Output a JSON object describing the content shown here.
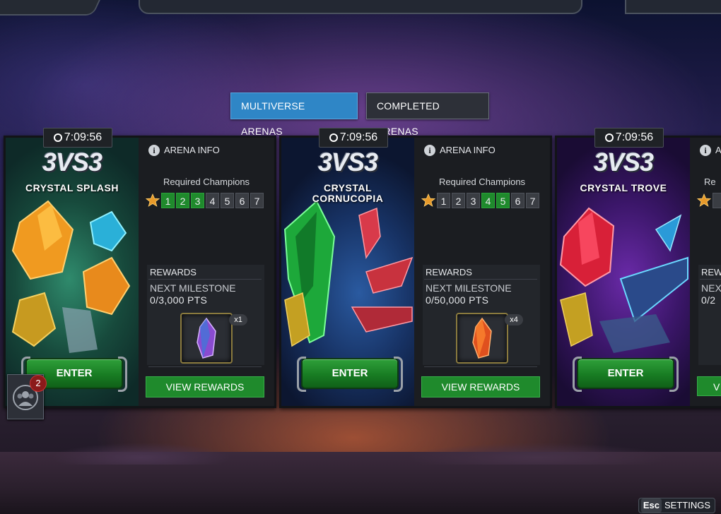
{
  "tabs": {
    "multiverse": "MULTIVERSE ARENAS",
    "completed": "COMPLETED ARENAS"
  },
  "arenas": [
    {
      "timer": "7:09:56",
      "mode": "3VS3",
      "name": "CRYSTAL SPLASH",
      "info_label": "ARENA INFO",
      "required_label": "Required Champions",
      "slots": [
        "1",
        "2",
        "3",
        "4",
        "5",
        "6",
        "7"
      ],
      "active_slots": [
        1,
        2,
        3
      ],
      "rewards_label": "REWARDS",
      "milestone_label": "NEXT MILESTONE",
      "points": "0/3,000 PTS",
      "reward_count": "x1",
      "enter_label": "ENTER",
      "view_rewards_label": "VIEW REWARDS",
      "theme_color": "#1f6e58",
      "reward_color": "#8a4bd0"
    },
    {
      "timer": "7:09:56",
      "mode": "3VS3",
      "name": "CRYSTAL CORNUCOPIA",
      "info_label": "ARENA INFO",
      "required_label": "Required Champions",
      "slots": [
        "1",
        "2",
        "3",
        "4",
        "5",
        "6",
        "7"
      ],
      "active_slots": [
        4,
        5
      ],
      "rewards_label": "REWARDS",
      "milestone_label": "NEXT MILESTONE",
      "points": "0/50,000 PTS",
      "reward_count": "x4",
      "enter_label": "ENTER",
      "view_rewards_label": "VIEW REWARDS",
      "theme_color": "#1a3f7a",
      "reward_color": "#e0501e"
    },
    {
      "timer": "7:09:56",
      "mode": "3VS3",
      "name": "CRYSTAL TROVE",
      "info_label": "ARENA INFO",
      "required_label": "Re",
      "slots": [],
      "active_slots": [],
      "rewards_label": "REW",
      "milestone_label": "NEX",
      "points": "0/2",
      "reward_count": "",
      "enter_label": "ENTER",
      "view_rewards_label": "V",
      "theme_color": "#4a1f7a",
      "reward_color": "#d02040"
    }
  ],
  "alliance": {
    "badge_count": "2"
  },
  "settings": {
    "key": "Esc",
    "label": "SETTINGS"
  },
  "colors": {
    "accent_blue": "#2f86c6",
    "green": "#1f8a2c",
    "panel": "#1e2126"
  }
}
